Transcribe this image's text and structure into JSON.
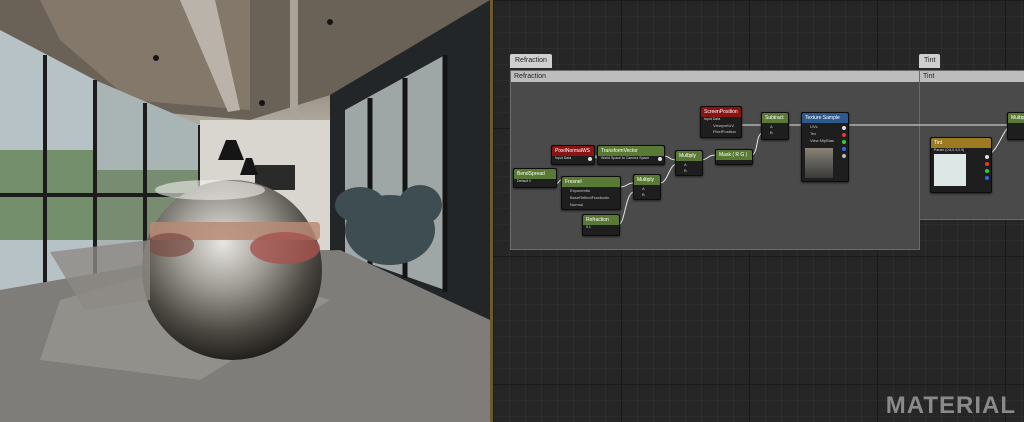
{
  "graph": {
    "comments": [
      {
        "tab": "Refraction",
        "title": "Refraction"
      },
      {
        "tab": "Tint",
        "title": "Tint"
      }
    ],
    "nodes": {
      "pixel_normal": {
        "title": "PixelNormalWS",
        "sub": "Input Data"
      },
      "transform_vector": {
        "title": "TransformVector",
        "sub": "World Space to Camera Space"
      },
      "screen_position": {
        "title": "ScreenPosition",
        "sub": "Input Data",
        "pins": [
          "ViewportUV",
          "PixelPosition"
        ]
      },
      "subtract": {
        "title": "Subtract",
        "pins": [
          "A",
          "B"
        ]
      },
      "texture_sample": {
        "title": "Texture Sample",
        "pins": [
          "UVs",
          "Tex",
          "View MipBias"
        ]
      },
      "multiply_a": {
        "title": "Multiply",
        "pins": [
          "A",
          "B"
        ]
      },
      "mask_rg": {
        "title": "Mask ( R G )"
      },
      "bent_spread": {
        "title": "BendSpread",
        "sub": "Default 0"
      },
      "fresnel": {
        "title": "Fresnel",
        "pins": [
          "ExponentIn",
          "BaseReflectFractionIn",
          "Normal"
        ]
      },
      "multiply_b": {
        "title": "Multiply",
        "pins": [
          "A",
          "B"
        ]
      },
      "refraction_param": {
        "title": "Refraction",
        "sub": "0.1"
      },
      "tint": {
        "title": "Tint",
        "sub": "Param (0.8,0.9,0.9)"
      },
      "multiply_c": {
        "title": "Multiply"
      }
    }
  },
  "watermark": "MATERIAL"
}
